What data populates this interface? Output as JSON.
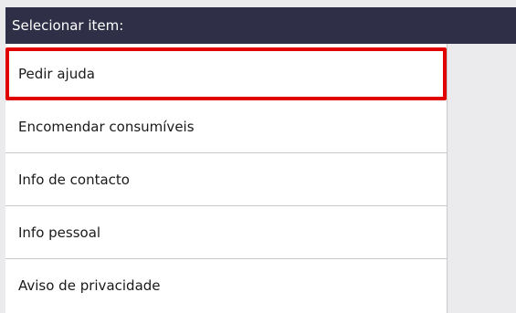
{
  "header": {
    "title": "Selecionar item:"
  },
  "menu": {
    "items": [
      {
        "label": "Pedir ajuda"
      },
      {
        "label": "Encomendar consumíveis"
      },
      {
        "label": "Info de contacto"
      },
      {
        "label": "Info pessoal"
      },
      {
        "label": "Aviso de privacidade"
      }
    ],
    "selected_index": 0
  },
  "colors": {
    "header_bg": "#2f3047",
    "selection_border": "#e00000",
    "panel_bg": "#ebebee"
  }
}
